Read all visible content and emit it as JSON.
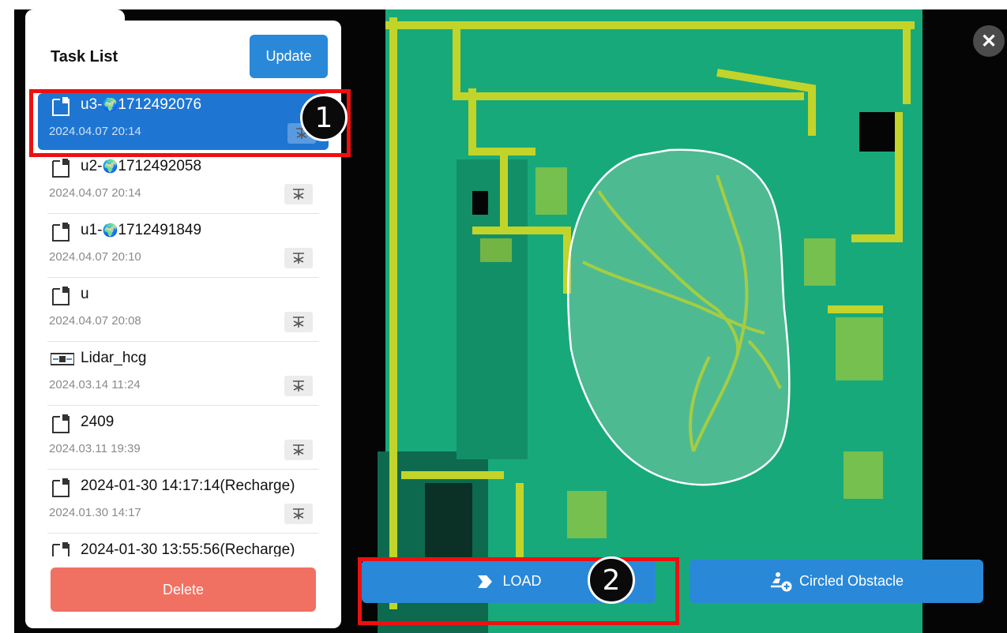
{
  "panel": {
    "title": "Task List",
    "update_label": "Update",
    "delete_label": "Delete",
    "tasks": [
      {
        "name": "u3-",
        "name_id": "1712492076",
        "has_globe": true,
        "date": "2024.04.07 20:14",
        "selected": true,
        "icon": "file-icon"
      },
      {
        "name": "u2-",
        "name_id": "1712492058",
        "has_globe": true,
        "date": "2024.04.07 20:14",
        "selected": false,
        "icon": "file-icon"
      },
      {
        "name": "u1-",
        "name_id": "1712491849",
        "has_globe": true,
        "date": "2024.04.07 20:10",
        "selected": false,
        "icon": "file-icon"
      },
      {
        "name": "u",
        "name_id": "",
        "has_globe": false,
        "date": "2024.04.07 20:08",
        "selected": false,
        "icon": "file-icon"
      },
      {
        "name": "Lidar_hcg",
        "name_id": "",
        "has_globe": false,
        "date": "2024.03.14 11:24",
        "selected": false,
        "icon": "lidar-icon"
      },
      {
        "name": "2409",
        "name_id": "",
        "has_globe": false,
        "date": "2024.03.11 19:39",
        "selected": false,
        "icon": "file-icon"
      },
      {
        "name": "2024-01-30 14:17:14(Recharge)",
        "name_id": "",
        "has_globe": false,
        "date": "2024.01.30 14:17",
        "selected": false,
        "icon": "file-icon"
      },
      {
        "name": "2024-01-30 13:55:56(Recharge)",
        "name_id": "",
        "has_globe": false,
        "date": "",
        "selected": false,
        "icon": "file-icon"
      }
    ]
  },
  "map": {
    "load_label": "LOAD",
    "circled_obstacle_label": "Circled Obstacle"
  },
  "annotations": {
    "badge_1": "1",
    "badge_2": "2"
  },
  "colors": {
    "accent": "#2a88d8",
    "selected": "#1e76d2",
    "delete": "#f07062",
    "highlight": "#ee1010",
    "map_green": "#17a878",
    "map_yellow": "#c2d42a"
  }
}
